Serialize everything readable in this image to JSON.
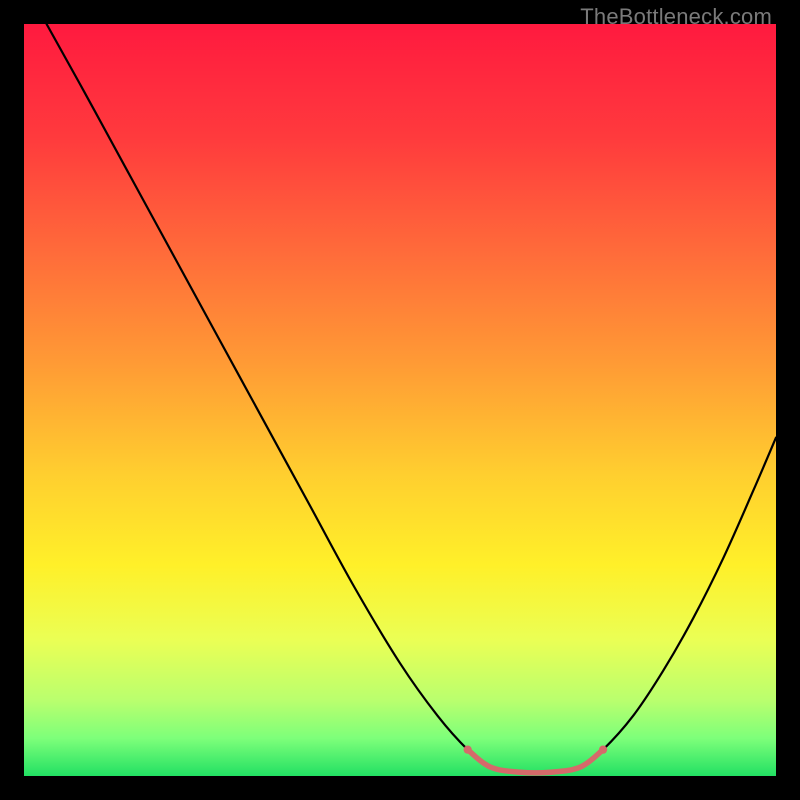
{
  "watermark": "TheBottleneck.com",
  "chart_data": {
    "type": "line",
    "title": "",
    "xlabel": "",
    "ylabel": "",
    "xlim": [
      0,
      100
    ],
    "ylim": [
      0,
      100
    ],
    "background_gradient_stops": [
      {
        "offset": 0.0,
        "color": "#ff1a3f"
      },
      {
        "offset": 0.15,
        "color": "#ff3a3d"
      },
      {
        "offset": 0.3,
        "color": "#ff6a3a"
      },
      {
        "offset": 0.45,
        "color": "#ff9a35"
      },
      {
        "offset": 0.6,
        "color": "#ffcf2f"
      },
      {
        "offset": 0.72,
        "color": "#fff029"
      },
      {
        "offset": 0.82,
        "color": "#eaff55"
      },
      {
        "offset": 0.9,
        "color": "#b9ff6e"
      },
      {
        "offset": 0.95,
        "color": "#7dff7a"
      },
      {
        "offset": 1.0,
        "color": "#22e063"
      }
    ],
    "series": [
      {
        "name": "curve",
        "stroke": "#000000",
        "stroke_width": 2.2,
        "points": [
          {
            "x": 3.0,
            "y": 100.0
          },
          {
            "x": 8.0,
            "y": 91.0
          },
          {
            "x": 14.0,
            "y": 80.0
          },
          {
            "x": 20.0,
            "y": 69.0
          },
          {
            "x": 26.0,
            "y": 58.0
          },
          {
            "x": 32.0,
            "y": 47.0
          },
          {
            "x": 38.0,
            "y": 36.0
          },
          {
            "x": 44.0,
            "y": 25.0
          },
          {
            "x": 50.0,
            "y": 15.0
          },
          {
            "x": 55.0,
            "y": 8.0
          },
          {
            "x": 59.0,
            "y": 3.5
          },
          {
            "x": 62.0,
            "y": 1.2
          },
          {
            "x": 66.0,
            "y": 0.5
          },
          {
            "x": 70.0,
            "y": 0.5
          },
          {
            "x": 74.0,
            "y": 1.2
          },
          {
            "x": 77.0,
            "y": 3.5
          },
          {
            "x": 81.0,
            "y": 8.0
          },
          {
            "x": 85.0,
            "y": 14.0
          },
          {
            "x": 89.0,
            "y": 21.0
          },
          {
            "x": 93.0,
            "y": 29.0
          },
          {
            "x": 97.0,
            "y": 38.0
          },
          {
            "x": 100.0,
            "y": 45.0
          }
        ]
      },
      {
        "name": "optimal-band",
        "stroke": "#d56a6a",
        "stroke_width": 5.5,
        "points": [
          {
            "x": 59.0,
            "y": 3.5
          },
          {
            "x": 62.0,
            "y": 1.2
          },
          {
            "x": 66.0,
            "y": 0.5
          },
          {
            "x": 70.0,
            "y": 0.5
          },
          {
            "x": 74.0,
            "y": 1.2
          },
          {
            "x": 77.0,
            "y": 3.5
          }
        ],
        "endpoints": [
          {
            "x": 59.0,
            "y": 3.5
          },
          {
            "x": 77.0,
            "y": 3.5
          }
        ]
      }
    ]
  }
}
